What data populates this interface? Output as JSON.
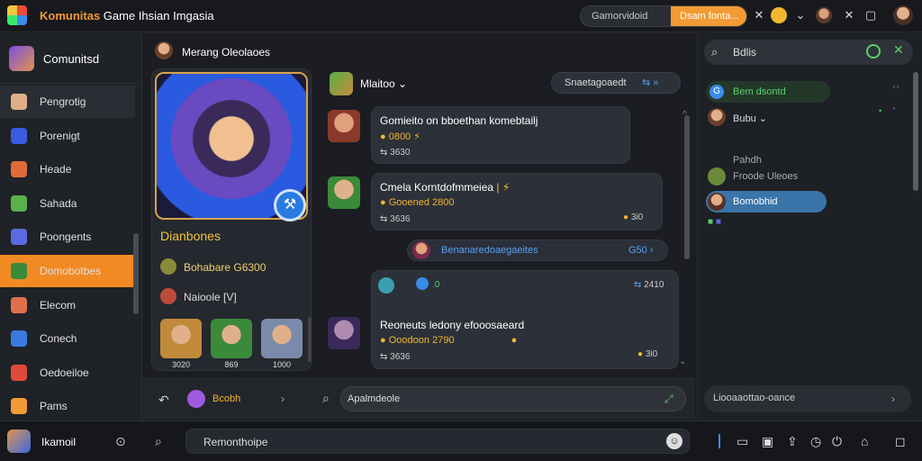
{
  "titlebar": {
    "brand": "Komunitas",
    "subtitle": "Game Ihsian Imgasia",
    "search_text": "Gamorvidoid",
    "search_button": "Dsam fonta..."
  },
  "sidebar": {
    "header_label": "Comunitsd",
    "items": [
      {
        "label": "Pengrotig",
        "color": "#e0b08a"
      },
      {
        "label": "Porenigt",
        "color": "#3a5ae0"
      },
      {
        "label": "Heade",
        "color": "#e06a3a"
      },
      {
        "label": "Sahada",
        "color": "#5ab04a"
      },
      {
        "label": "Poongents",
        "color": "#5a6ae0"
      },
      {
        "label": "Domobotbes",
        "color": "#3a8a3a"
      },
      {
        "label": "Elecom",
        "color": "#e0704a"
      },
      {
        "label": "Conech",
        "color": "#3a7ae0"
      },
      {
        "label": "Oedoeiloe",
        "color": "#e04a3a"
      },
      {
        "label": "Pams",
        "color": "#f29a34"
      }
    ],
    "active_index": 5
  },
  "profile": {
    "header_name": "Merang Oleolaoes",
    "hero_name": "Dianbones",
    "stat1": "Bohabare G6300",
    "stat2": "Naioole [V]",
    "thumbs": [
      {
        "label": "3020",
        "color": "#c08a3a"
      },
      {
        "label": "869",
        "color": "#3a8a3a"
      },
      {
        "label": "1000",
        "color": "#7a8aaa"
      }
    ]
  },
  "chat": {
    "header_name": "Mlaitoo",
    "filter_text": "Snaetagoaedt",
    "messages": [
      {
        "text": "Gomieito on bboethan komebtailj",
        "gold": "0800",
        "meta": "3630"
      },
      {
        "text": "Cmela Korntdofmmeiea",
        "gold": "Gooened 2800",
        "meta": "3636",
        "reaction": "3i0"
      },
      {
        "text": "Reoneuts ledony efooosaeard",
        "gold": "Ooodoon 2790",
        "meta": "3636",
        "reaction": "3i0",
        "header_tag": ".0",
        "header_right": "2410"
      }
    ],
    "system_banner": "Benanaredoaegaeites",
    "system_banner_tag": "G50",
    "input_placeholder": "Apalmdeole",
    "reply_name": "Bcobh"
  },
  "right_panel": {
    "search_text": "Bdlis",
    "pill1": "Bem dsontd",
    "row2": "Bubu",
    "section": "Pahdh",
    "row3": "Froode Uleoes",
    "pill2": "Bomobhid",
    "bottom_text": "Liooaaottao-oance"
  },
  "bottombar": {
    "name": "Ikamoil",
    "input_text": "Remonthoipe"
  }
}
